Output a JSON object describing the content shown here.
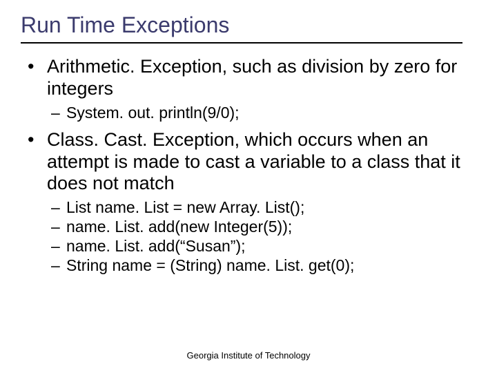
{
  "title": "Run Time Exceptions",
  "bullets": [
    {
      "text": "Arithmetic. Exception, such as division by zero for integers",
      "sub": [
        "System. out. println(9/0);"
      ]
    },
    {
      "text": "Class. Cast. Exception, which occurs when an attempt is made to cast a variable to a class that it does not match",
      "sub": [
        "List name. List = new Array. List();",
        "name. List. add(new Integer(5));",
        "name. List. add(“Susan”);",
        "String name = (String) name. List. get(0);"
      ]
    }
  ],
  "footer": "Georgia Institute of Technology"
}
